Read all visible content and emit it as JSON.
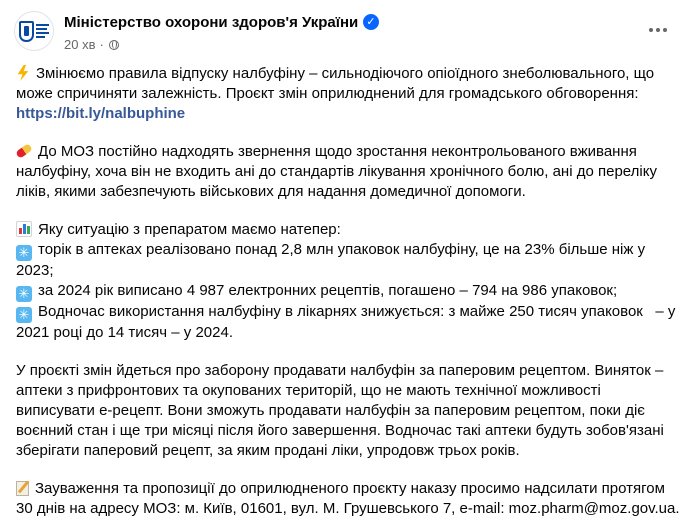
{
  "post": {
    "page_name": "Міністерство охорони здоров'я України",
    "time": "20 хв",
    "dot": "·",
    "avatar": {
      "lines": [
        "МІНІСТЕРСТВО",
        "ОХОРОНИ",
        "ЗДОРОВ'Я",
        "УКРАЇНИ"
      ]
    },
    "verified_glyph": "✓",
    "icons": {
      "verified": "verified-badge-icon",
      "audience": "globe-icon",
      "options": "more-options-icon"
    },
    "colors": {
      "accent": "#0866ff",
      "link": "#385898",
      "muted": "#65676b"
    }
  },
  "content": {
    "p1": {
      "icon": "lightning-icon",
      "lines": [
        "Змінюємо правила відпуску налбуфіну – сильнодіючого опіоїдного знеболювального, що",
        "може спричиняти залежність. Проєкт змін оприлюднений для громадського обговорення:"
      ],
      "link": "https://bit.ly/nalbuphine"
    },
    "p2": {
      "icon": "pill-icon",
      "lines": [
        "До МОЗ постійно надходять звернення щодо зростання неконтрольованого вживання",
        "налбуфіну, хоча він не входить ані до стандартів лікування хронічного болю, ані до переліку",
        "ліків, якими забезпечують військових для надання домедичної допомоги."
      ]
    },
    "p3": {
      "icon": "bar-chart-icon",
      "intro": "Яку ситуацію з препаратом маємо натепер:",
      "bullets": [
        {
          "icon": "snowflake-icon",
          "lines": [
            "торік в аптеках реалізовано понад 2,8 млн упаковок налбуфіну, це на 23% більше ніж у",
            "2023;"
          ]
        },
        {
          "icon": "snowflake-icon",
          "lines": [
            "за 2024 рік виписано 4 987 електронних рецептів, погашено – 794 на 986 упаковок;"
          ]
        },
        {
          "icon": "snowflake-icon",
          "lines": [
            "Водночас використання налбуфіну в лікарнях знижується: з майже 250 тисяч упаковок   – у",
            "2021 році до 14 тисяч – у 2024."
          ]
        }
      ]
    },
    "p4": {
      "lines": [
        "У проєкті змін йдеться про заборону продавати налбуфін за паперовим рецептом. Виняток –",
        "аптеки з прифронтових та окупованих територій, що не мають технічної можливості",
        "виписувати е-рецепт. Вони зможуть продавати налбуфін за паперовим рецептом, поки діє",
        "воєнний стан і ще три місяці після його завершення. Водночас такі аптеки будуть зобов'язані",
        "зберігати паперовий рецепт, за яким продані ліки, упродовж трьох років."
      ]
    },
    "p5": {
      "icon": "memo-icon",
      "lines": [
        "Зауваження та пропозиції до оприлюдненого проєкту наказу просимо надсилати протягом",
        "30 днів на адресу МОЗ: м. Київ, 01601, вул. М. Грушевського 7, e-mail: moz.pharm@moz.gov.ua."
      ]
    }
  }
}
